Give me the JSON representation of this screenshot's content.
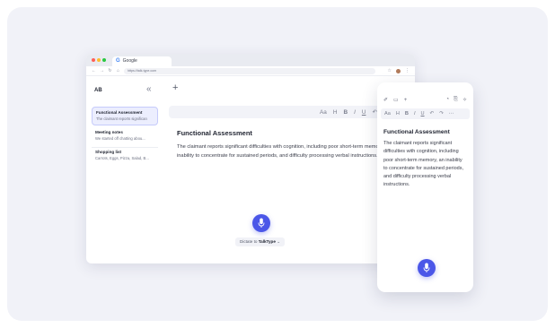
{
  "colors": {
    "accent": "#4b57e8",
    "background_card": "#f1f2f8",
    "active_note_bg": "#eceefe"
  },
  "browser": {
    "tab_title": "Google",
    "tab_logo": "G",
    "url": "https://talk-type.com",
    "window_controls": [
      "close",
      "minimize",
      "maximize"
    ]
  },
  "sidebar": {
    "initials": "AB",
    "collapse_icon": "double-chevron-left-icon",
    "notes": [
      {
        "title": "Functional Assessment",
        "snippet": "The claimant reports significan"
      },
      {
        "title": "Meeting notes",
        "snippet": "We started off chatting abou..."
      },
      {
        "title": "Shopping list",
        "snippet": "Carrots, Eggs, Pizza, Salad, B..."
      }
    ]
  },
  "toolbar": {
    "font_size": "Aa",
    "heading": "H",
    "bold": "B",
    "italic": "I",
    "underline": "U",
    "icons": [
      "undo-icon",
      "redo-icon",
      "copy-icon",
      "export-icon",
      "history-icon",
      "magic-icon"
    ]
  },
  "document": {
    "title": "Functional Assessment",
    "body": "The claimant reports significant difficulties with cognition, including poor short-term memory, an inability to concentrate for sustained periods, and difficulty processing verbal instructions."
  },
  "dictate": {
    "prefix": "Dictate to ",
    "brand": "TalkType",
    "chevron": "⌄"
  },
  "phone": {
    "toolbar": {
      "font_size": "Aa",
      "heading": "H",
      "bold": "B",
      "italic": "I",
      "underline": "U"
    },
    "title": "Functional Assessment",
    "body": "The claimant reports significant difficulties with cognition, including poor short-term memory, an inability to concentrate for sustained periods, and difficulty processing verbal instructions."
  }
}
